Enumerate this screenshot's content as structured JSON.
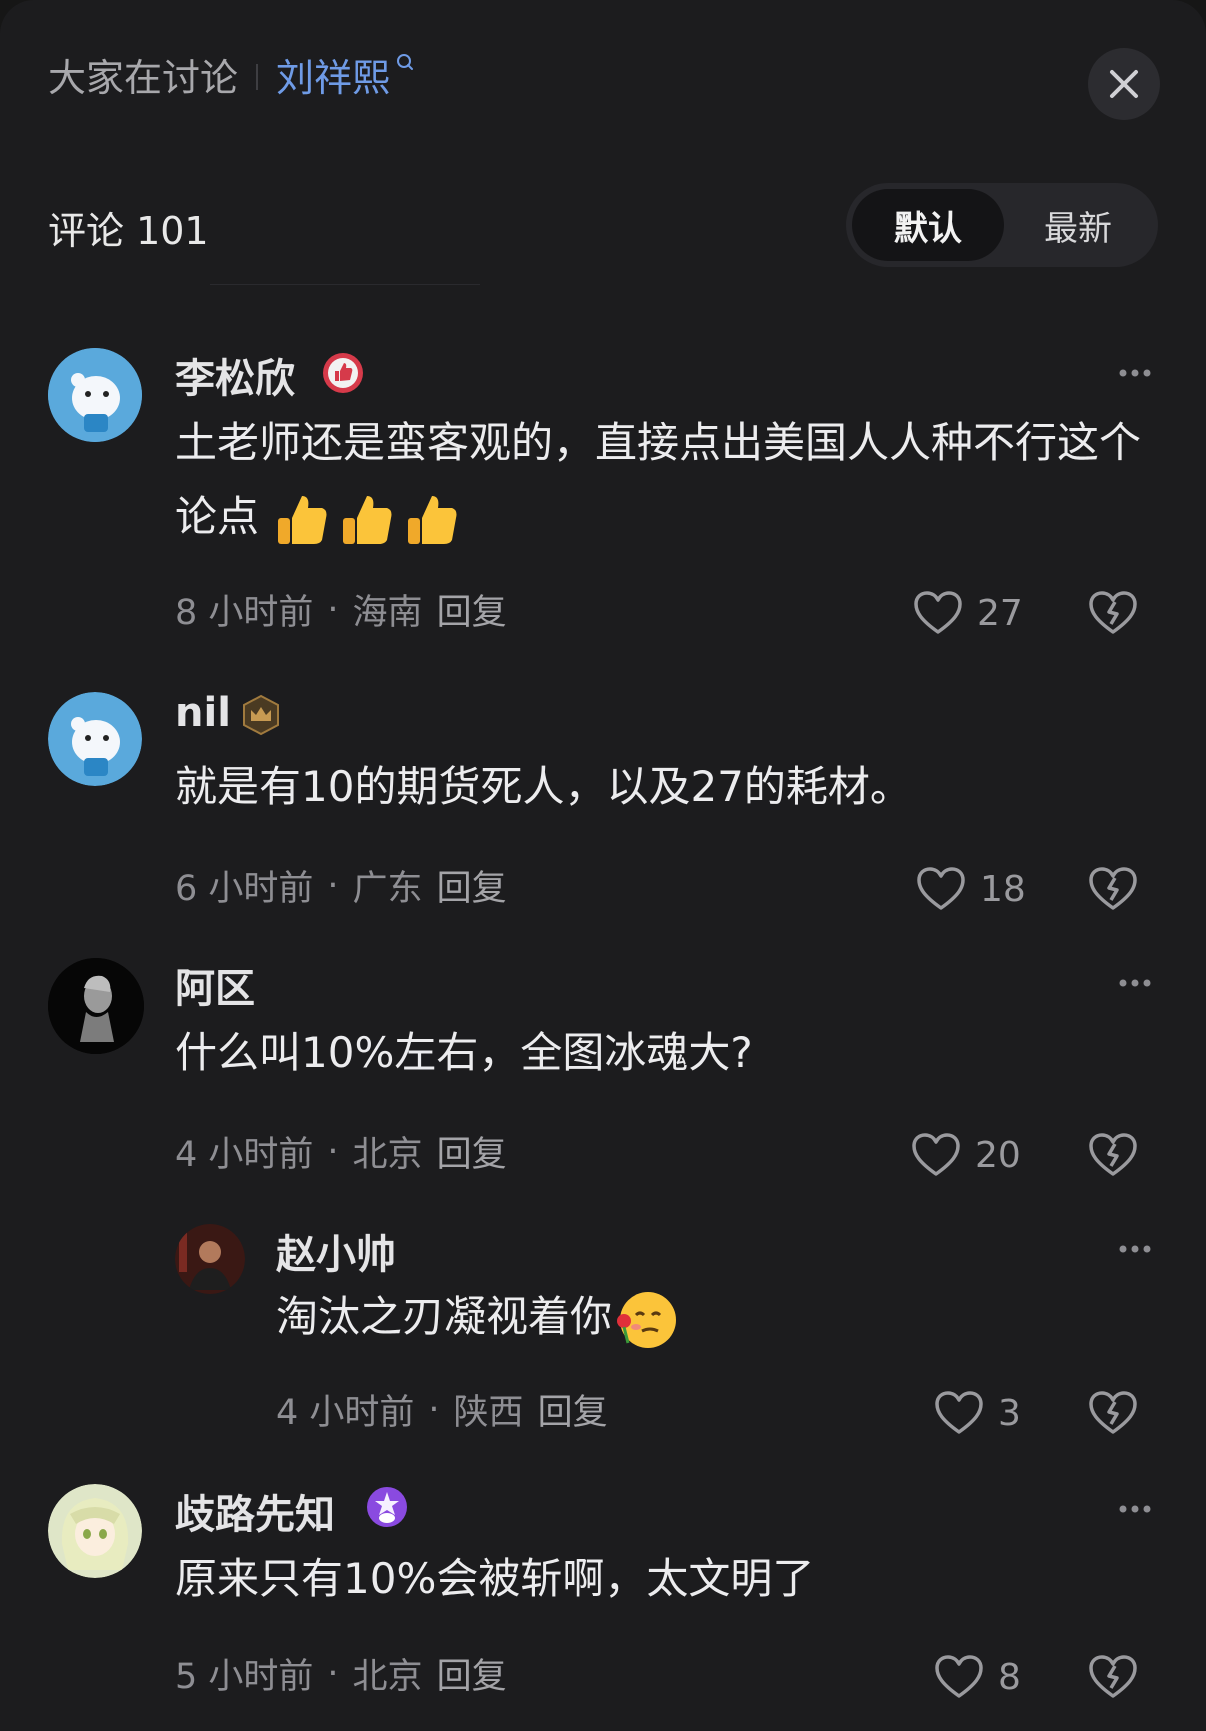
{
  "header": {
    "title": "大家在讨论",
    "topic": "刘祥熙"
  },
  "comments_count_label": "评论 101",
  "sort": {
    "default_label": "默认",
    "latest_label": "最新"
  },
  "comments": [
    {
      "username": "李松欣",
      "text": "土老师还是蛮客观的，直接点出美国人人种不行这个论点",
      "time": "8 小时前",
      "location": "海南",
      "reply_label": "回复",
      "likes": "27"
    },
    {
      "username": "nil",
      "text": "就是有10的期货死人，以及27的耗材。",
      "time": "6 小时前",
      "location": "广东",
      "reply_label": "回复",
      "likes": "18"
    },
    {
      "username": "阿区",
      "text": "什么叫10%左右，全图冰魂大?",
      "time": "4 小时前",
      "location": "北京",
      "reply_label": "回复",
      "likes": "20"
    },
    {
      "username": "赵小帅",
      "text": "淘汰之刃凝视着你",
      "time": "4 小时前",
      "location": "陕西",
      "reply_label": "回复",
      "likes": "3"
    },
    {
      "username": "歧路先知",
      "text": "原来只有10%会被斩啊，太文明了",
      "time": "5 小时前",
      "location": "北京",
      "reply_label": "回复",
      "likes": "8"
    }
  ],
  "icons": {
    "close": "close-icon",
    "search": "search-icon",
    "like": "heart-icon",
    "dislike": "broken-heart-icon",
    "more": "more-dots-icon"
  },
  "colors": {
    "topic": "#6f9be6",
    "background": "#1c1c1e"
  }
}
